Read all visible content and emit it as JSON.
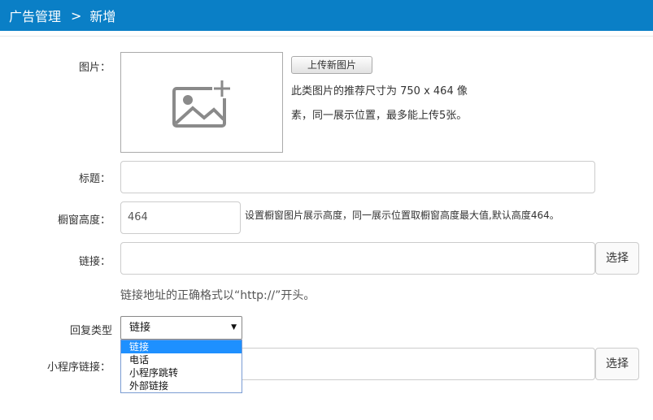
{
  "header": {
    "section": "广告管理",
    "separator": ">",
    "page": "新增"
  },
  "form": {
    "image": {
      "label": "图片：",
      "upload_button": "上传新图片",
      "hint_line1": "此类图片的推荐尺寸为 750 x 464 像",
      "hint_line2": "素，同一展示位置，最多能上传5张。",
      "placeholder_icon": "image-placeholder-icon"
    },
    "title": {
      "label": "标题：",
      "value": ""
    },
    "height": {
      "label": "橱窗高度：",
      "value": "464",
      "hint": "设置橱窗图片展示高度，同一展示位置取橱窗高度最大值,默认高度464。"
    },
    "link": {
      "label": "链接：",
      "value": "",
      "select_button": "选择",
      "hint": "链接地址的正确格式以“http://”开头。"
    },
    "reply_type": {
      "label": "回复类型",
      "selected": "链接",
      "options": [
        "链接",
        "电话",
        "小程序跳转",
        "外部链接"
      ]
    },
    "miniprogram_link": {
      "label": "小程序链接：",
      "value": "",
      "select_button": "选择"
    }
  }
}
